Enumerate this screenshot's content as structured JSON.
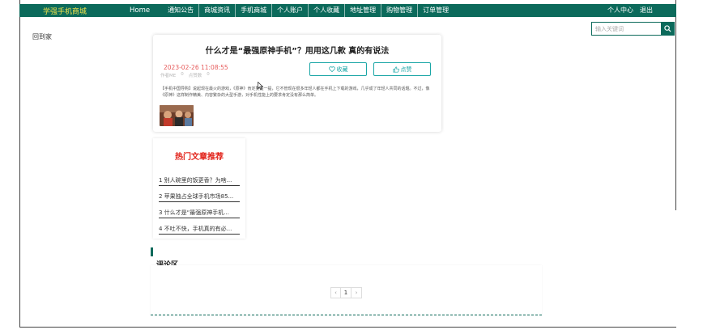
{
  "nav": {
    "brand": "学强手机商城",
    "items": [
      "Home",
      "通知公告",
      "商城资讯",
      "手机商城",
      "个人账户",
      "个人收藏",
      "地址管理",
      "购物管理",
      "订单管理"
    ],
    "user_center": "个人中心",
    "logout": "退出"
  },
  "search": {
    "placeholder": "输入关键词",
    "icon": "search-icon"
  },
  "back": "回到家",
  "article": {
    "title": "什么才是“最强原神手机”？用用这几款 真的有说法",
    "date": "2023-02-26 11:08:55",
    "meta": [
      "作者ME",
      "0",
      "点赞数",
      "0"
    ],
    "favorite_label": "收藏",
    "like_label": "点赞",
    "favorite_icon": "heart-icon",
    "like_icon": "thumbs-up-icon",
    "body": "【手机中国导购】说起现在最火的游戏，《原神》肯定要提一提，它不管现在很多年轻人都在手机上下载的游戏，几乎成了年轻人共同的话题。不过，像《原神》这样制作精美、内容繁杂的大型手游，对手机性能上的要求肯定没有那么简单。"
  },
  "hot": {
    "title": "热门文章推荐",
    "items": [
      "1 别人碗里的饭更香？为啥...",
      "2 苹果独占全球手机市场85...",
      "3 什么才是“最强原神手机...",
      "4 不吐不快，手机真的有必..."
    ]
  },
  "comments": {
    "title": "评论区",
    "pager": {
      "prev": "‹",
      "page": "1",
      "next": "›"
    }
  },
  "colors": {
    "primary": "#0c6a5b",
    "brand_text": "#f1e34d",
    "accent": "#1aa6a6",
    "hot_title": "#e2231a",
    "date": "#e65b5b"
  }
}
